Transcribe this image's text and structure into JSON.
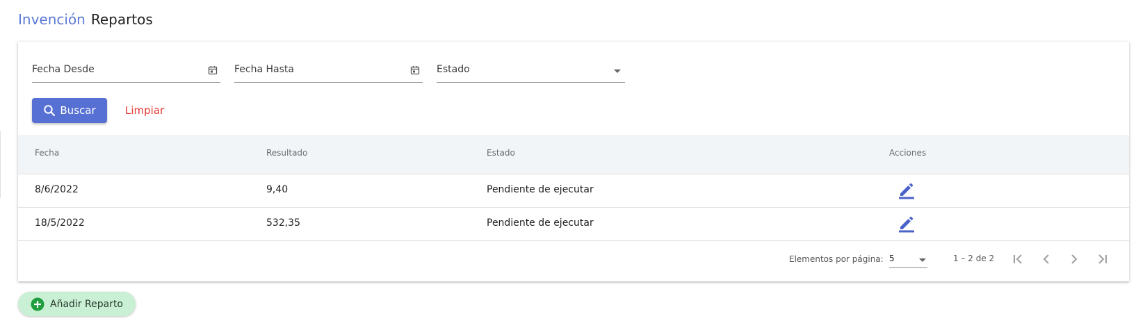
{
  "breadcrumb": {
    "parent": "Invención",
    "current": "Repartos"
  },
  "filters": {
    "fecha_desde": {
      "label": "Fecha Desde",
      "icon": "calendar-icon"
    },
    "fecha_hasta": {
      "label": "Fecha Hasta",
      "icon": "calendar-icon"
    },
    "estado": {
      "label": "Estado"
    }
  },
  "actions": {
    "search_label": "Buscar",
    "clear_label": "Limpiar",
    "search_icon": "search-icon"
  },
  "table": {
    "columns": [
      "Fecha",
      "Resultado",
      "Estado",
      "Acciones"
    ],
    "rows": [
      {
        "fecha": "8/6/2022",
        "resultado": "9,40",
        "estado": "Pendiente de ejecutar",
        "action_icon": "edit-icon"
      },
      {
        "fecha": "18/5/2022",
        "resultado": "532,35",
        "estado": "Pendiente de ejecutar",
        "action_icon": "edit-icon"
      }
    ]
  },
  "paginator": {
    "items_per_page_label": "Elementos por página:",
    "page_size": "5",
    "range": "1 – 2 de 2"
  },
  "add_button": {
    "label": "Añadir Reparto",
    "icon": "plus-circle-icon"
  },
  "colors": {
    "primary": "#5670d3",
    "breadcrumb_link": "#5c7ad6",
    "clear": "#e53b36",
    "add_bg": "#c9f0d4",
    "add_icon": "#1e9e3e",
    "edit_icon": "#4a63c8"
  }
}
